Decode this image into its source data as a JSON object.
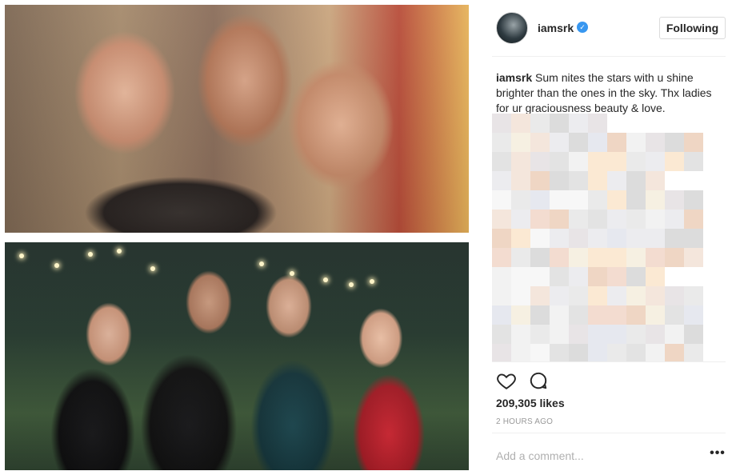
{
  "post": {
    "username": "iamsrk",
    "verified": true,
    "follow_label": "Following",
    "caption_user": "iamsrk",
    "caption_text": "Sum nites the stars with u shine brighter than the ones in the sky. Thx ladies for ur graciousness beauty & love.",
    "likes": "209,305 likes",
    "timestamp": "2 HOURS AGO",
    "comment_placeholder": "Add a comment...",
    "more_label": "•••"
  },
  "icons": {
    "verified": "verified-badge-icon",
    "like": "heart-icon",
    "comment": "comment-bubble-icon",
    "more": "more-options-icon"
  },
  "colors": {
    "accent": "#3897f0",
    "text": "#262626",
    "muted": "#999999",
    "border": "#dbdbdb"
  }
}
